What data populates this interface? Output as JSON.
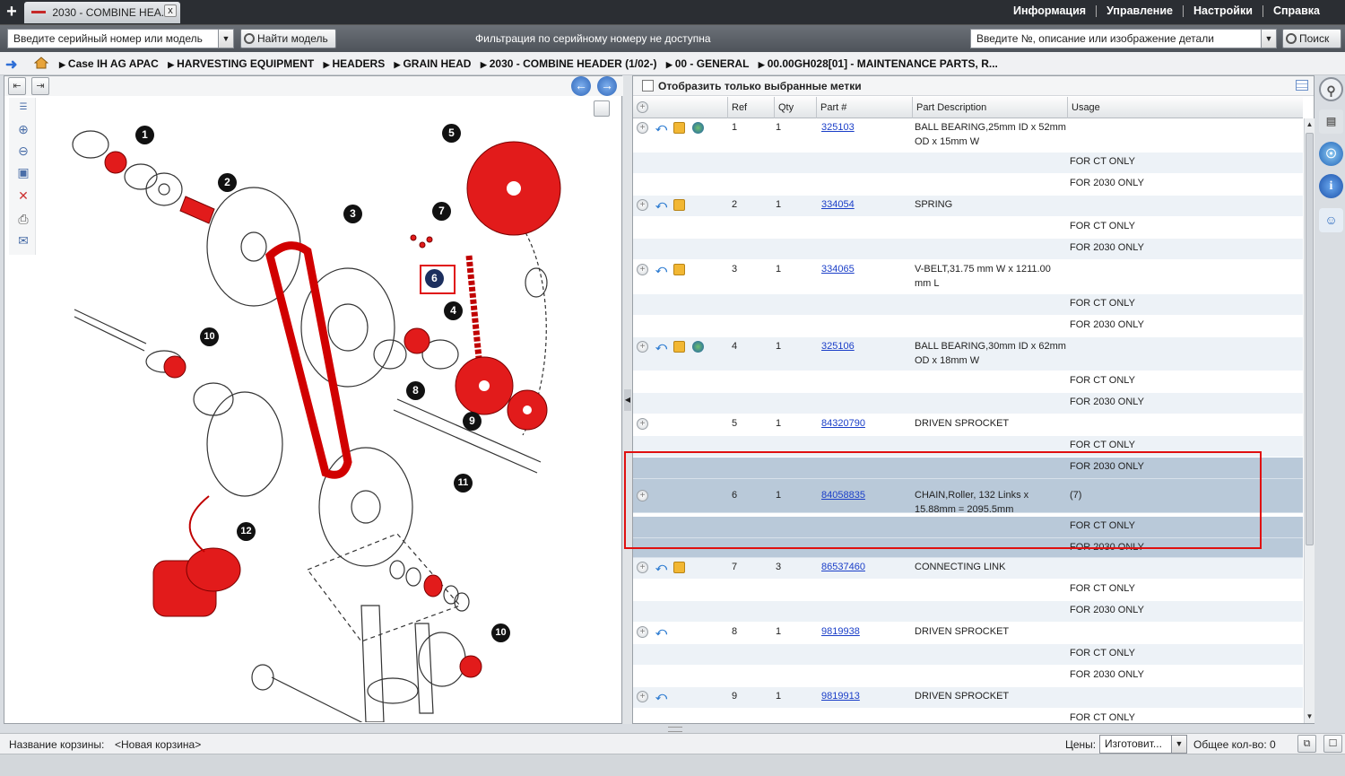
{
  "topbar": {
    "new_tab": "+",
    "tab_title": "2030 - COMBINE HEA...",
    "tab_close": "x",
    "menu": [
      "Информация",
      "Управление",
      "Настройки",
      "Справка"
    ]
  },
  "toolbar": {
    "serial_placeholder": "Введите серийный номер или модель",
    "find_model": "Найти модель",
    "filter_message": "Фильтрация по серийному номеру не доступна",
    "part_search_placeholder": "Введите №, описание или изображение детали",
    "search": "Поиск"
  },
  "breadcrumb": [
    "Case IH AG APAC",
    "HARVESTING EQUIPMENT",
    "HEADERS",
    "GRAIN HEAD",
    "2030 - COMBINE HEADER (1/02-)",
    "00 - GENERAL",
    "00.00GH028[01] - MAINTENANCE PARTS, R..."
  ],
  "diagram": {
    "callouts": [
      "1",
      "2",
      "3",
      "4",
      "5",
      "6",
      "7",
      "8",
      "9",
      "10",
      "11",
      "12",
      "10"
    ],
    "accent": "#e21b1b"
  },
  "parts_panel": {
    "show_selected_label": "Отобразить только выбранные метки",
    "columns": [
      "Ref",
      "Qty",
      "Part #",
      "Part Description",
      "Usage"
    ],
    "rows": [
      {
        "ref": "1",
        "qty": "1",
        "part": "325103",
        "desc": "BALL BEARING,25mm ID x 52mm OD x 15mm W",
        "usage": "",
        "icons": [
          "arrow-icon",
          "box-icon",
          "globe-icon"
        ],
        "notes": [
          "FOR CT ONLY",
          "FOR 2030 ONLY"
        ]
      },
      {
        "ref": "2",
        "qty": "1",
        "part": "334054",
        "desc": "SPRING",
        "usage": "",
        "icons": [
          "arrow-icon",
          "box-icon"
        ],
        "notes": [
          "FOR CT ONLY",
          "FOR 2030 ONLY"
        ]
      },
      {
        "ref": "3",
        "qty": "1",
        "part": "334065",
        "desc": "V-BELT,31.75 mm W x 1211.00 mm L",
        "usage": "",
        "icons": [
          "arrow-icon",
          "box-icon"
        ],
        "notes": [
          "FOR CT ONLY",
          "FOR 2030 ONLY"
        ]
      },
      {
        "ref": "4",
        "qty": "1",
        "part": "325106",
        "desc": "BALL BEARING,30mm ID x 62mm OD x 18mm W",
        "usage": "",
        "icons": [
          "arrow-icon",
          "box-icon",
          "globe-icon"
        ],
        "notes": [
          "FOR CT ONLY",
          "FOR 2030 ONLY"
        ]
      },
      {
        "ref": "5",
        "qty": "1",
        "part": "84320790",
        "desc": "DRIVEN SPROCKET",
        "usage": "",
        "icons": [],
        "notes": [
          "FOR CT ONLY",
          "FOR 2030 ONLY"
        ]
      },
      {
        "ref": "6",
        "qty": "1",
        "part": "84058835",
        "desc": "CHAIN,Roller, 132 Links x 15.88mm = 2095.5mm",
        "usage": "(7)",
        "icons": [],
        "notes": [
          "FOR CT ONLY",
          "FOR 2030 ONLY"
        ]
      },
      {
        "ref": "7",
        "qty": "3",
        "part": "86537460",
        "desc": "CONNECTING LINK",
        "usage": "",
        "icons": [
          "arrow-icon",
          "box-icon"
        ],
        "notes": [
          "FOR CT ONLY",
          "FOR 2030 ONLY"
        ]
      },
      {
        "ref": "8",
        "qty": "1",
        "part": "9819938",
        "desc": "DRIVEN SPROCKET",
        "usage": "",
        "icons": [
          "arrow-icon"
        ],
        "notes": [
          "FOR CT ONLY",
          "FOR 2030 ONLY"
        ]
      },
      {
        "ref": "9",
        "qty": "1",
        "part": "9819913",
        "desc": "DRIVEN SPROCKET",
        "usage": "",
        "icons": [
          "arrow-icon"
        ],
        "notes": [
          "FOR CT ONLY"
        ]
      }
    ]
  },
  "statusbar": {
    "cart_label": "Название корзины:",
    "cart_value": "<Новая корзина>",
    "prices_label": "Цены:",
    "prices_value": "Изготовит...",
    "total": "Общее кол-во: 0"
  }
}
